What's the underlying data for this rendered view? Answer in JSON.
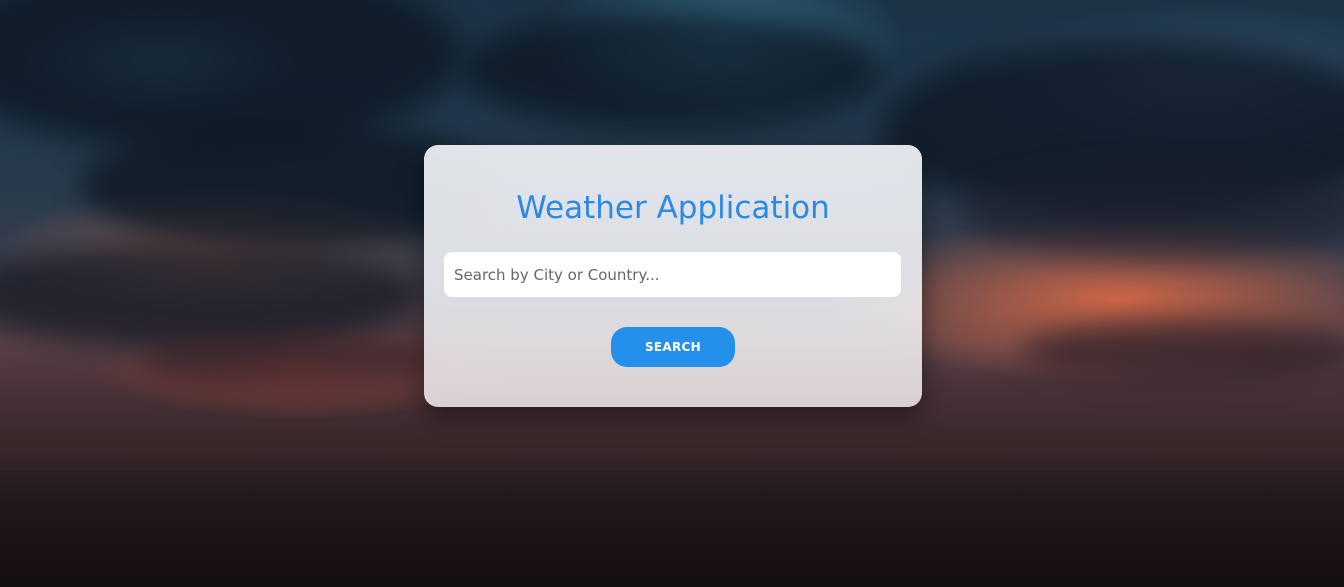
{
  "app": {
    "title": "Weather Application"
  },
  "search": {
    "placeholder": "Search by City or Country...",
    "value": "",
    "button_label": "SEARCH"
  },
  "colors": {
    "accent": "#2b8ae8",
    "button": "#2490ec",
    "card": "#eef0f4"
  }
}
